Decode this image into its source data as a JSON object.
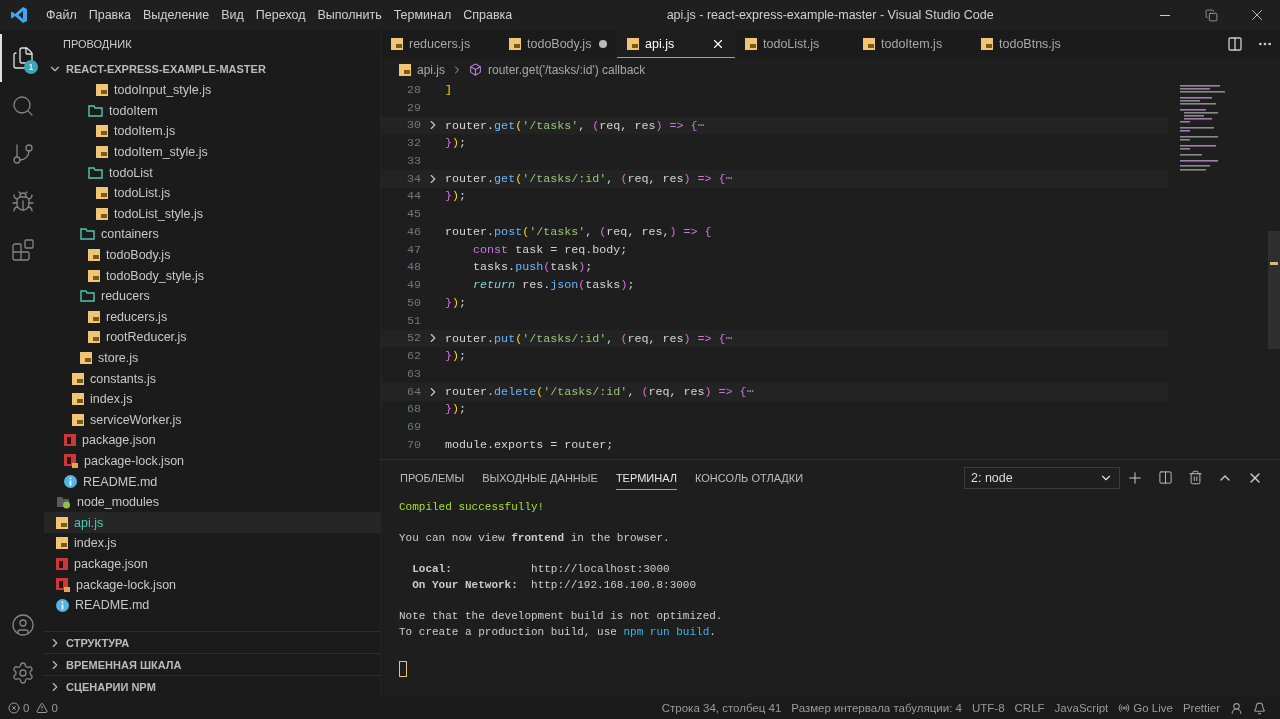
{
  "window": {
    "title": "api.js - react-express-example-master - Visual Studio Code"
  },
  "menu": [
    "Файл",
    "Правка",
    "Выделение",
    "Вид",
    "Переход",
    "Выполнить",
    "Терминал",
    "Справка"
  ],
  "activity_bar": [
    {
      "kind": "explorer",
      "selected": true,
      "badge": "1"
    },
    {
      "kind": "search",
      "selected": false
    },
    {
      "kind": "source-control",
      "selected": false
    },
    {
      "kind": "run",
      "selected": false
    },
    {
      "kind": "extensions",
      "selected": false
    }
  ],
  "activity_bar_bottom": [
    {
      "kind": "account"
    },
    {
      "kind": "settings"
    }
  ],
  "sidebar": {
    "title": "ПРОВОДНИК",
    "root": {
      "label": "REACT-EXPRESS-EXAMPLE-MASTER",
      "expanded": true
    },
    "tree": [
      {
        "children": [
          {
            "children": [
              {
                "children": [
                  {
                    "children": [
                      {
                        "children": [
                          {
                            "label": "todoInput_style.js",
                            "kind": "js",
                            "selected": false
                          }
                        ]
                      },
                      {
                        "label": "todoItem",
                        "kind": "folder",
                        "expanded": true,
                        "selected": false,
                        "children": [
                          {
                            "label": "todoItem.js",
                            "kind": "js",
                            "selected": false
                          },
                          {
                            "label": "todoItem_style.js",
                            "kind": "js",
                            "selected": false
                          }
                        ]
                      },
                      {
                        "label": "todoList",
                        "kind": "folder",
                        "expanded": true,
                        "selected": false,
                        "children": [
                          {
                            "label": "todoList.js",
                            "kind": "js",
                            "selected": false
                          },
                          {
                            "label": "todoList_style.js",
                            "kind": "js",
                            "selected": false
                          }
                        ]
                      }
                    ]
                  },
                  {
                    "label": "containers",
                    "kind": "folder",
                    "expanded": true,
                    "selected": false,
                    "children": [
                      {
                        "label": "todoBody.js",
                        "kind": "js",
                        "selected": false
                      },
                      {
                        "label": "todoBody_style.js",
                        "kind": "js",
                        "selected": false
                      }
                    ]
                  },
                  {
                    "label": "reducers",
                    "kind": "folder",
                    "expanded": true,
                    "selected": false,
                    "children": [
                      {
                        "label": "reducers.js",
                        "kind": "js",
                        "selected": false
                      },
                      {
                        "label": "rootReducer.js",
                        "kind": "js",
                        "selected": false
                      }
                    ]
                  },
                  {
                    "label": "store.js",
                    "kind": "js",
                    "selected": false
                  }
                ]
              },
              {
                "label": "constants.js",
                "kind": "js",
                "selected": false
              },
              {
                "label": "index.js",
                "kind": "js",
                "selected": false
              },
              {
                "label": "serviceWorker.js",
                "kind": "js",
                "selected": false
              }
            ]
          },
          {
            "label": "package.json",
            "kind": "npm",
            "selected": false
          },
          {
            "label": "package-lock.json",
            "kind": "npm-lock",
            "selected": false
          },
          {
            "label": "README.md",
            "kind": "info",
            "selected": false
          }
        ]
      },
      {
        "label": "node_modules",
        "kind": "modules",
        "expanded": false,
        "selected": false
      },
      {
        "label": "api.js",
        "kind": "js",
        "selected": true
      },
      {
        "label": "index.js",
        "kind": "js",
        "selected": false
      },
      {
        "label": "package.json",
        "kind": "npm",
        "selected": false
      },
      {
        "label": "package-lock.json",
        "kind": "npm-lock",
        "selected": false
      },
      {
        "label": "README.md",
        "kind": "info",
        "selected": false
      }
    ],
    "sections": [
      {
        "label": "СТРУКТУРА",
        "expanded": false
      },
      {
        "label": "ВРЕМЕННАЯ ШКАЛА",
        "expanded": false
      },
      {
        "label": "СЦЕНАРИИ NPM",
        "expanded": false
      }
    ]
  },
  "tabs": [
    {
      "label": "reducers.js",
      "selected": false,
      "modified": false
    },
    {
      "label": "todoBody.js",
      "selected": false,
      "modified": true
    },
    {
      "label": "api.js",
      "selected": true,
      "modified": false
    },
    {
      "label": "todoList.js",
      "selected": false,
      "modified": false
    },
    {
      "label": "todoItem.js",
      "selected": false,
      "modified": false
    },
    {
      "label": "todoBtns.js",
      "selected": false,
      "modified": false
    }
  ],
  "breadcrumb": [
    "api.js",
    "router.get('/tasks/:id') callback"
  ],
  "code": [
    {
      "num": "28",
      "tokens": [
        {
          "text": "]",
          "kind": "bracket"
        }
      ]
    },
    {
      "num": "29"
    },
    {
      "num": "30",
      "folded": true,
      "tokens": [
        {
          "text": "router.",
          "kind": "plain"
        },
        {
          "text": "get",
          "kind": "fn"
        },
        {
          "text": "(",
          "kind": "bracket"
        },
        {
          "text": "'/tasks'",
          "kind": "str"
        },
        {
          "text": ", ",
          "kind": "plain"
        },
        {
          "text": "(",
          "kind": "paren"
        },
        {
          "text": "req, res",
          "kind": "plain"
        },
        {
          "text": ")",
          "kind": "paren"
        },
        {
          "text": " => {",
          "kind": "kw"
        },
        {
          "text": "⋯",
          "kind": "fold"
        }
      ]
    },
    {
      "num": "32",
      "tokens": [
        {
          "text": "}",
          "kind": "paren"
        },
        {
          "text": ")",
          "kind": "bracket"
        },
        {
          "text": ";",
          "kind": "plain"
        }
      ]
    },
    {
      "num": "33"
    },
    {
      "num": "34",
      "folded": true,
      "tokens": [
        {
          "text": "router.",
          "kind": "plain"
        },
        {
          "text": "get",
          "kind": "fn"
        },
        {
          "text": "(",
          "kind": "bracket"
        },
        {
          "text": "'/tasks/:id'",
          "kind": "str"
        },
        {
          "text": ", ",
          "kind": "plain"
        },
        {
          "text": "(",
          "kind": "paren"
        },
        {
          "text": "req, res",
          "kind": "plain"
        },
        {
          "text": ")",
          "kind": "paren"
        },
        {
          "text": " => {",
          "kind": "kw"
        },
        {
          "text": "⋯",
          "kind": "fold"
        }
      ]
    },
    {
      "num": "44",
      "tokens": [
        {
          "text": "}",
          "kind": "paren"
        },
        {
          "text": ")",
          "kind": "bracket"
        },
        {
          "text": ";",
          "kind": "plain"
        }
      ]
    },
    {
      "num": "45"
    },
    {
      "num": "46",
      "tokens": [
        {
          "text": "router.",
          "kind": "plain"
        },
        {
          "text": "post",
          "kind": "fn"
        },
        {
          "text": "(",
          "kind": "bracket"
        },
        {
          "text": "'/tasks'",
          "kind": "str"
        },
        {
          "text": ", ",
          "kind": "plain"
        },
        {
          "text": "(",
          "kind": "paren"
        },
        {
          "text": "req, res,",
          "kind": "plain"
        },
        {
          "text": ")",
          "kind": "paren"
        },
        {
          "text": " => {",
          "kind": "kw"
        }
      ]
    },
    {
      "num": "47",
      "tokens": [
        {
          "text": "    const",
          "kind": "kw"
        },
        {
          "text": " task = req.body;",
          "kind": "plain"
        }
      ]
    },
    {
      "num": "48",
      "tokens": [
        {
          "text": "    tasks.",
          "kind": "plain"
        },
        {
          "text": "push",
          "kind": "fn"
        },
        {
          "text": "(",
          "kind": "paren"
        },
        {
          "text": "task",
          "kind": "plain"
        },
        {
          "text": ")",
          "kind": "paren"
        },
        {
          "text": ";",
          "kind": "plain"
        }
      ]
    },
    {
      "num": "49",
      "tokens": [
        {
          "text": "    return",
          "kind": "kw-italic"
        },
        {
          "text": " res.",
          "kind": "plain"
        },
        {
          "text": "json",
          "kind": "fn"
        },
        {
          "text": "(",
          "kind": "paren"
        },
        {
          "text": "tasks",
          "kind": "plain"
        },
        {
          "text": ")",
          "kind": "paren"
        },
        {
          "text": ";",
          "kind": "plain"
        }
      ]
    },
    {
      "num": "50",
      "tokens": [
        {
          "text": "}",
          "kind": "paren"
        },
        {
          "text": ")",
          "kind": "bracket"
        },
        {
          "text": ";",
          "kind": "plain"
        }
      ]
    },
    {
      "num": "51"
    },
    {
      "num": "52",
      "folded": true,
      "tokens": [
        {
          "text": "router.",
          "kind": "plain"
        },
        {
          "text": "put",
          "kind": "fn"
        },
        {
          "text": "(",
          "kind": "bracket"
        },
        {
          "text": "'/tasks/:id'",
          "kind": "str"
        },
        {
          "text": ", ",
          "kind": "plain"
        },
        {
          "text": "(",
          "kind": "paren"
        },
        {
          "text": "req, res",
          "kind": "plain"
        },
        {
          "text": ")",
          "kind": "paren"
        },
        {
          "text": " => {",
          "kind": "kw"
        },
        {
          "text": "⋯",
          "kind": "fold"
        }
      ]
    },
    {
      "num": "62",
      "tokens": [
        {
          "text": "}",
          "kind": "paren"
        },
        {
          "text": ")",
          "kind": "bracket"
        },
        {
          "text": ";",
          "kind": "plain"
        }
      ]
    },
    {
      "num": "63"
    },
    {
      "num": "64",
      "folded": true,
      "tokens": [
        {
          "text": "router.",
          "kind": "plain"
        },
        {
          "text": "delete",
          "kind": "fn"
        },
        {
          "text": "(",
          "kind": "bracket"
        },
        {
          "text": "'/tasks/:id'",
          "kind": "str"
        },
        {
          "text": ", ",
          "kind": "plain"
        },
        {
          "text": "(",
          "kind": "paren"
        },
        {
          "text": "req, res",
          "kind": "plain"
        },
        {
          "text": ")",
          "kind": "paren"
        },
        {
          "text": " => {",
          "kind": "kw"
        },
        {
          "text": "⋯",
          "kind": "fold"
        }
      ]
    },
    {
      "num": "68",
      "tokens": [
        {
          "text": "}",
          "kind": "paren"
        },
        {
          "text": ")",
          "kind": "bracket"
        },
        {
          "text": ";",
          "kind": "plain"
        }
      ]
    },
    {
      "num": "69"
    },
    {
      "num": "70",
      "tokens": [
        {
          "text": "module.exports = router;",
          "kind": "plain"
        }
      ]
    }
  ],
  "panel": {
    "tabs": [
      {
        "label": "ПРОБЛЕМЫ",
        "selected": false
      },
      {
        "label": "ВЫХОДНЫЕ ДАННЫЕ",
        "selected": false
      },
      {
        "label": "ТЕРМИНАЛ",
        "selected": true
      },
      {
        "label": "КОНСОЛЬ ОТЛАДКИ",
        "selected": false
      }
    ],
    "terminal_select": "2: node",
    "terminal": [
      {
        "kind": "text",
        "segments": [
          {
            "text": "Compiled successfully!",
            "kind": "success"
          }
        ]
      },
      {
        "kind": "blank"
      },
      {
        "kind": "text",
        "segments": [
          {
            "text": "You can now view **frontend** in the browser.",
            "kind": "plain"
          }
        ]
      },
      {
        "kind": "blank"
      },
      {
        "kind": "text",
        "segments": [
          {
            "text": "  **Local:**            http://localhost:3000",
            "kind": "plain"
          }
        ]
      },
      {
        "kind": "text",
        "segments": [
          {
            "text": "  **On Your Network:**  http://192.168.100.8:3000",
            "kind": "plain"
          }
        ]
      },
      {
        "kind": "blank"
      },
      {
        "kind": "text",
        "segments": [
          {
            "text": "Note that the development build is not optimized.",
            "kind": "plain"
          }
        ]
      },
      {
        "kind": "text",
        "segments": [
          {
            "text": "To create a production build, use ",
            "kind": "plain"
          },
          {
            "text": "npm run build",
            "kind": "command"
          },
          {
            "text": ".",
            "kind": "plain"
          }
        ]
      }
    ]
  },
  "status_bar": {
    "errors": "0",
    "warnings": "0",
    "items": [
      {
        "label": "Строка 34, столбец 41"
      },
      {
        "label": "Размер интервала табуляции: 4"
      },
      {
        "label": "UTF-8"
      },
      {
        "label": "CRLF"
      },
      {
        "label": "JavaScript"
      },
      {
        "label": "Go Live",
        "kind": "live"
      },
      {
        "label": "Prettier"
      }
    ]
  }
}
